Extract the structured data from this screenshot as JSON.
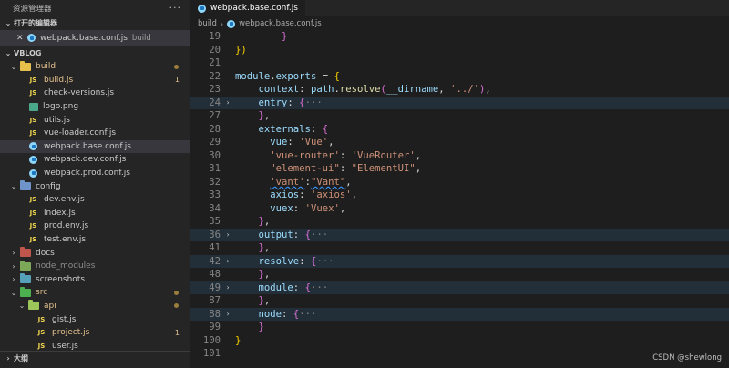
{
  "explorer": {
    "title": "资源管理器",
    "more_icon": "ellipsis-icon",
    "open_editors_label": "打开的编辑器",
    "open_editor": {
      "name": "webpack.base.conf.js",
      "desc": "build"
    },
    "project_label": "VBLOG",
    "outline_label": "大纲"
  },
  "tree": [
    {
      "name": "build",
      "kind": "folder",
      "folder": "f-build",
      "depth": 1,
      "expanded": true,
      "status": "dot",
      "mod": true
    },
    {
      "name": "build.js",
      "kind": "js",
      "depth": 2,
      "badge": "1",
      "mod": true
    },
    {
      "name": "check-versions.js",
      "kind": "js",
      "depth": 2
    },
    {
      "name": "logo.png",
      "kind": "img",
      "depth": 2
    },
    {
      "name": "utils.js",
      "kind": "js",
      "depth": 2
    },
    {
      "name": "vue-loader.conf.js",
      "kind": "js",
      "depth": 2
    },
    {
      "name": "webpack.base.conf.js",
      "kind": "webpack",
      "depth": 2,
      "selected": true
    },
    {
      "name": "webpack.dev.conf.js",
      "kind": "webpack",
      "depth": 2
    },
    {
      "name": "webpack.prod.conf.js",
      "kind": "webpack",
      "depth": 2
    },
    {
      "name": "config",
      "kind": "folder",
      "folder": "f-config",
      "depth": 1,
      "expanded": true
    },
    {
      "name": "dev.env.js",
      "kind": "js",
      "depth": 2
    },
    {
      "name": "index.js",
      "kind": "js",
      "depth": 2
    },
    {
      "name": "prod.env.js",
      "kind": "js",
      "depth": 2
    },
    {
      "name": "test.env.js",
      "kind": "js",
      "depth": 2
    },
    {
      "name": "docs",
      "kind": "folder",
      "folder": "f-docs",
      "depth": 1,
      "expanded": false
    },
    {
      "name": "node_modules",
      "kind": "folder",
      "folder": "f-nm",
      "depth": 1,
      "expanded": false,
      "dim": true
    },
    {
      "name": "screenshots",
      "kind": "folder",
      "folder": "f-shots",
      "depth": 1,
      "expanded": false
    },
    {
      "name": "src",
      "kind": "folder",
      "folder": "f-src",
      "depth": 1,
      "expanded": true,
      "status": "dot",
      "mod": true
    },
    {
      "name": "api",
      "kind": "folder",
      "folder": "f-api",
      "depth": 2,
      "expanded": true,
      "status": "dot",
      "mod": true
    },
    {
      "name": "gist.js",
      "kind": "js",
      "depth": 3
    },
    {
      "name": "project.js",
      "kind": "js",
      "depth": 3,
      "badge": "1",
      "mod": true
    },
    {
      "name": "user.js",
      "kind": "js",
      "depth": 3
    }
  ],
  "editor": {
    "tab_label": "webpack.base.conf.js",
    "breadcrumb_folder": "build",
    "breadcrumb_file": "webpack.base.conf.js"
  },
  "code": [
    {
      "n": "19",
      "fold": "",
      "hl": false,
      "html": "        <span class='b2'>}</span>"
    },
    {
      "n": "20",
      "fold": "",
      "hl": false,
      "html": "<span class='b'>})</span>"
    },
    {
      "n": "21",
      "fold": "",
      "hl": false,
      "html": ""
    },
    {
      "n": "22",
      "fold": "",
      "hl": false,
      "html": "<span class='p'>module</span>.<span class='p'>exports</span> = <span class='b'>{</span>"
    },
    {
      "n": "23",
      "fold": "",
      "hl": false,
      "html": "    <span class='p'>context</span>: <span class='v'>path</span>.<span class='f'>resolve</span><span class='b2'>(</span><span class='v'>__dirname</span>, <span class='s'>'../'</span><span class='b2'>)</span>,"
    },
    {
      "n": "24",
      "fold": ">",
      "hl": true,
      "html": "    <span class='p'>entry</span>: <span class='b2'>{</span><span class='dots'>···</span>"
    },
    {
      "n": "27",
      "fold": "",
      "hl": false,
      "html": "    <span class='b2'>}</span>,"
    },
    {
      "n": "28",
      "fold": "",
      "hl": false,
      "html": "    <span class='p'>externals</span>: <span class='b2'>{</span>"
    },
    {
      "n": "29",
      "fold": "",
      "hl": false,
      "html": "      <span class='p'>vue</span>: <span class='s'>'Vue'</span>,"
    },
    {
      "n": "30",
      "fold": "",
      "hl": false,
      "html": "      <span class='s'>'vue-router'</span>: <span class='s'>'VueRouter'</span>,"
    },
    {
      "n": "31",
      "fold": "",
      "hl": false,
      "html": "      <span class='s'>\"element-ui\"</span>: <span class='s'>\"ElementUI\"</span>,"
    },
    {
      "n": "32",
      "fold": "",
      "hl": false,
      "html": "      <span class='s squig'>'vant'</span>:<span class='s squig'>\"Vant\"</span>,"
    },
    {
      "n": "33",
      "fold": "",
      "hl": false,
      "html": "      <span class='p'>axios</span>: <span class='s'>'axios'</span>,"
    },
    {
      "n": "34",
      "fold": "",
      "hl": false,
      "html": "      <span class='p'>vuex</span>: <span class='s'>'Vuex'</span>,"
    },
    {
      "n": "35",
      "fold": "",
      "hl": false,
      "html": "    <span class='b2'>}</span>,"
    },
    {
      "n": "36",
      "fold": ">",
      "hl": true,
      "html": "    <span class='p'>output</span>: <span class='b2'>{</span><span class='dots'>···</span>"
    },
    {
      "n": "41",
      "fold": "",
      "hl": false,
      "html": "    <span class='b2'>}</span>,"
    },
    {
      "n": "42",
      "fold": ">",
      "hl": true,
      "html": "    <span class='p'>resolve</span>: <span class='b2'>{</span><span class='dots'>···</span>"
    },
    {
      "n": "48",
      "fold": "",
      "hl": false,
      "html": "    <span class='b2'>}</span>,"
    },
    {
      "n": "49",
      "fold": ">",
      "hl": true,
      "html": "    <span class='p'>module</span>: <span class='b2'>{</span><span class='dots'>···</span>"
    },
    {
      "n": "87",
      "fold": "",
      "hl": false,
      "html": "    <span class='b2'>}</span>,"
    },
    {
      "n": "88",
      "fold": ">",
      "hl": true,
      "html": "    <span class='p'>node</span>: <span class='b2'>{</span><span class='dots'>···</span>"
    },
    {
      "n": "99",
      "fold": "",
      "hl": false,
      "html": "    <span class='b2'>}</span>"
    },
    {
      "n": "100",
      "fold": "",
      "hl": false,
      "html": "<span class='b'>}</span>"
    },
    {
      "n": "101",
      "fold": "",
      "hl": false,
      "html": ""
    }
  ],
  "watermark": "CSDN @shewlong"
}
